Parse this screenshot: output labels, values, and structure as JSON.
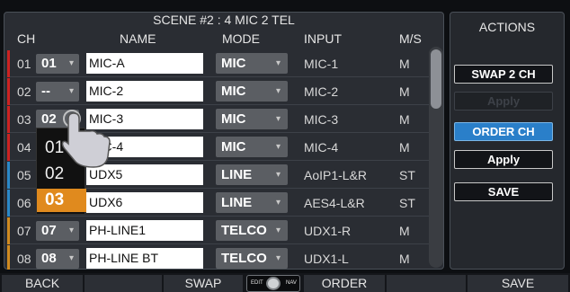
{
  "scene": {
    "title": "SCENE #2 : 4 MIC 2 TEL"
  },
  "headers": {
    "ch": "CH",
    "name": "NAME",
    "mode": "MODE",
    "input": "INPUT",
    "ms": "M/S"
  },
  "rows": [
    {
      "ch": "01",
      "sel": "01",
      "name": "MIC-A",
      "mode": "MIC",
      "input": "MIC-1",
      "ms": "M",
      "accent": "#cc2222"
    },
    {
      "ch": "02",
      "sel": "--",
      "name": "MIC-2",
      "mode": "MIC",
      "input": "MIC-2",
      "ms": "M",
      "accent": "#cc2222"
    },
    {
      "ch": "03",
      "sel": "02",
      "name": "MIC-3",
      "mode": "MIC",
      "input": "MIC-3",
      "ms": "M",
      "accent": "#cc2222"
    },
    {
      "ch": "04",
      "sel": "",
      "name": "MIC-4",
      "mode": "MIC",
      "input": "MIC-4",
      "ms": "M",
      "accent": "#cc2222"
    },
    {
      "ch": "05",
      "sel": "",
      "name": "UDX5",
      "mode": "LINE",
      "input": "AoIP1-L&R",
      "ms": "ST",
      "accent": "#2a88c8"
    },
    {
      "ch": "06",
      "sel": "",
      "name": "UDX6",
      "mode": "LINE",
      "input": "AES4-L&R",
      "ms": "ST",
      "accent": "#2a88c8"
    },
    {
      "ch": "07",
      "sel": "07",
      "name": "PH-LINE1",
      "mode": "TELCO",
      "input": "UDX1-R",
      "ms": "M",
      "accent": "#d08a20"
    },
    {
      "ch": "08",
      "sel": "08",
      "name": "PH-LINE BT",
      "mode": "TELCO",
      "input": "UDX1-L",
      "ms": "M",
      "accent": "#d08a20"
    }
  ],
  "dropdown": {
    "options": [
      "01",
      "02",
      "03"
    ],
    "selected": "03"
  },
  "actions": {
    "title": "ACTIONS",
    "swap": "SWAP 2 CH",
    "apply_disabled": "Apply",
    "order": "ORDER CH",
    "apply": "Apply",
    "save": "SAVE"
  },
  "bottom": {
    "back": "BACK",
    "swap": "SWAP",
    "edit": "EDIT",
    "nav": "NAV",
    "order": "ORDER",
    "save": "SAVE"
  },
  "colors": {
    "accent_blue": "#2a7fc9",
    "dropdown_selected": "#e08a1e"
  }
}
